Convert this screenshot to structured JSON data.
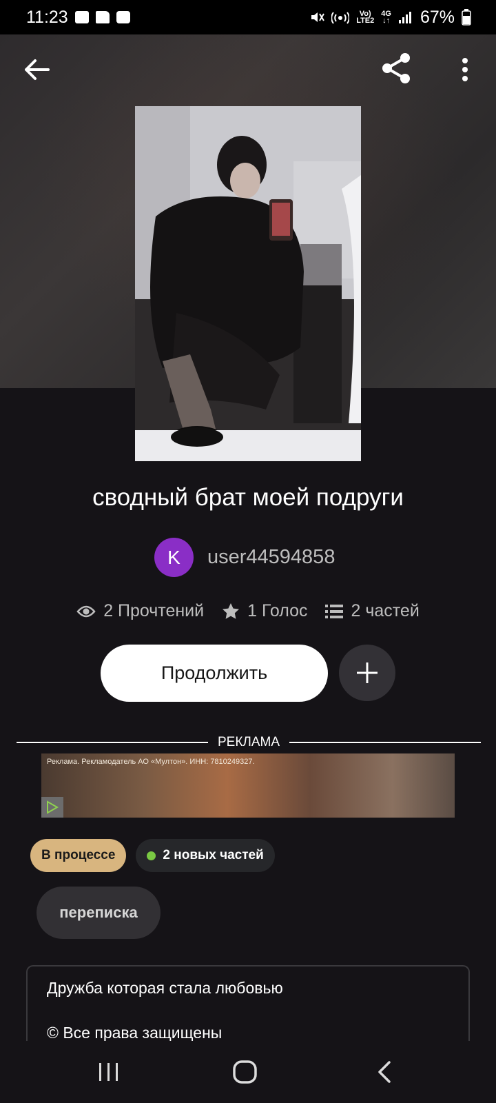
{
  "status_bar": {
    "time": "11:23",
    "battery": "67%",
    "net_top": "Vo)",
    "net_bottom": "LTE2",
    "gen_top": "4G",
    "gen_bottom": "↓↑"
  },
  "story": {
    "title": "сводный брат моей подруги",
    "author_initial": "K",
    "author": "user44594858",
    "reads": "2 Прочтений",
    "votes": "1 Голос",
    "parts": "2 частей"
  },
  "actions": {
    "continue_label": "Продолжить"
  },
  "ad": {
    "label": "РЕКЛАМА",
    "banner_text": "Реклама. Рекламодатель АО «Мултон». ИНН: 7810249327."
  },
  "badges": {
    "status": "В процессе",
    "new_parts": "2 новых частей"
  },
  "tags": [
    "переписка"
  ],
  "description": {
    "line1": "Дружба которая стала любовью",
    "line2": "© Все права защищены"
  },
  "colors": {
    "background": "#151317",
    "avatar": "#8a2ec6",
    "status_badge": "#d8b57f",
    "new_dot": "#7ac943"
  },
  "icons": [
    "back-arrow-icon",
    "share-icon",
    "more-vertical-icon",
    "eye-icon",
    "star-icon",
    "list-icon",
    "plus-icon",
    "play-icon"
  ]
}
